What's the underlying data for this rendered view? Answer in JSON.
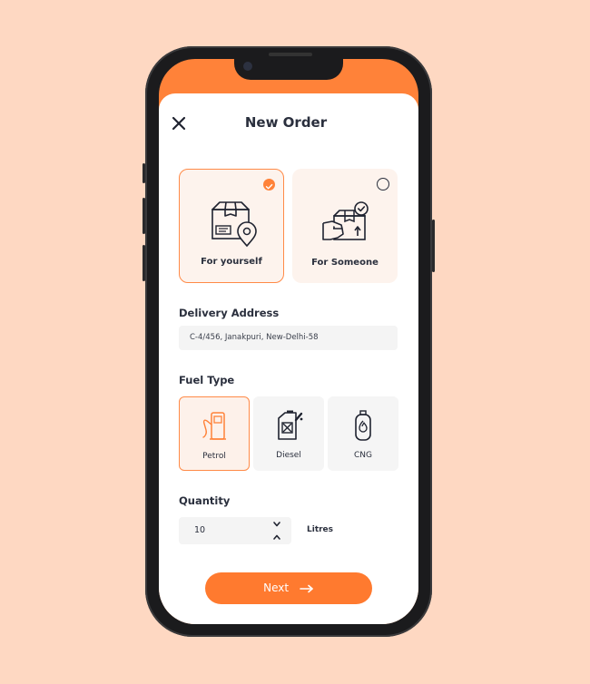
{
  "header": {
    "title": "New Order",
    "close_icon": "close-icon"
  },
  "recipient": {
    "options": [
      {
        "label": "For yourself",
        "icon": "package-location-icon",
        "selected": true
      },
      {
        "label": "For Someone",
        "icon": "hand-package-icon",
        "selected": false
      }
    ]
  },
  "delivery": {
    "heading": "Delivery Address",
    "value": "C-4/456, Janakpuri, New-Delhi-58"
  },
  "fuel": {
    "heading": "Fuel Type",
    "options": [
      {
        "label": "Petrol",
        "icon": "fuel-pump-icon",
        "selected": true
      },
      {
        "label": "Diesel",
        "icon": "jerrycan-icon",
        "selected": false
      },
      {
        "label": "CNG",
        "icon": "gas-cylinder-icon",
        "selected": false
      }
    ]
  },
  "quantity": {
    "heading": "Quantity",
    "value": "10",
    "unit": "Litres"
  },
  "footer": {
    "next_label": "Next"
  },
  "colors": {
    "accent": "#ff8239",
    "background": "#fed8c2",
    "text": "#2a2f3d"
  }
}
